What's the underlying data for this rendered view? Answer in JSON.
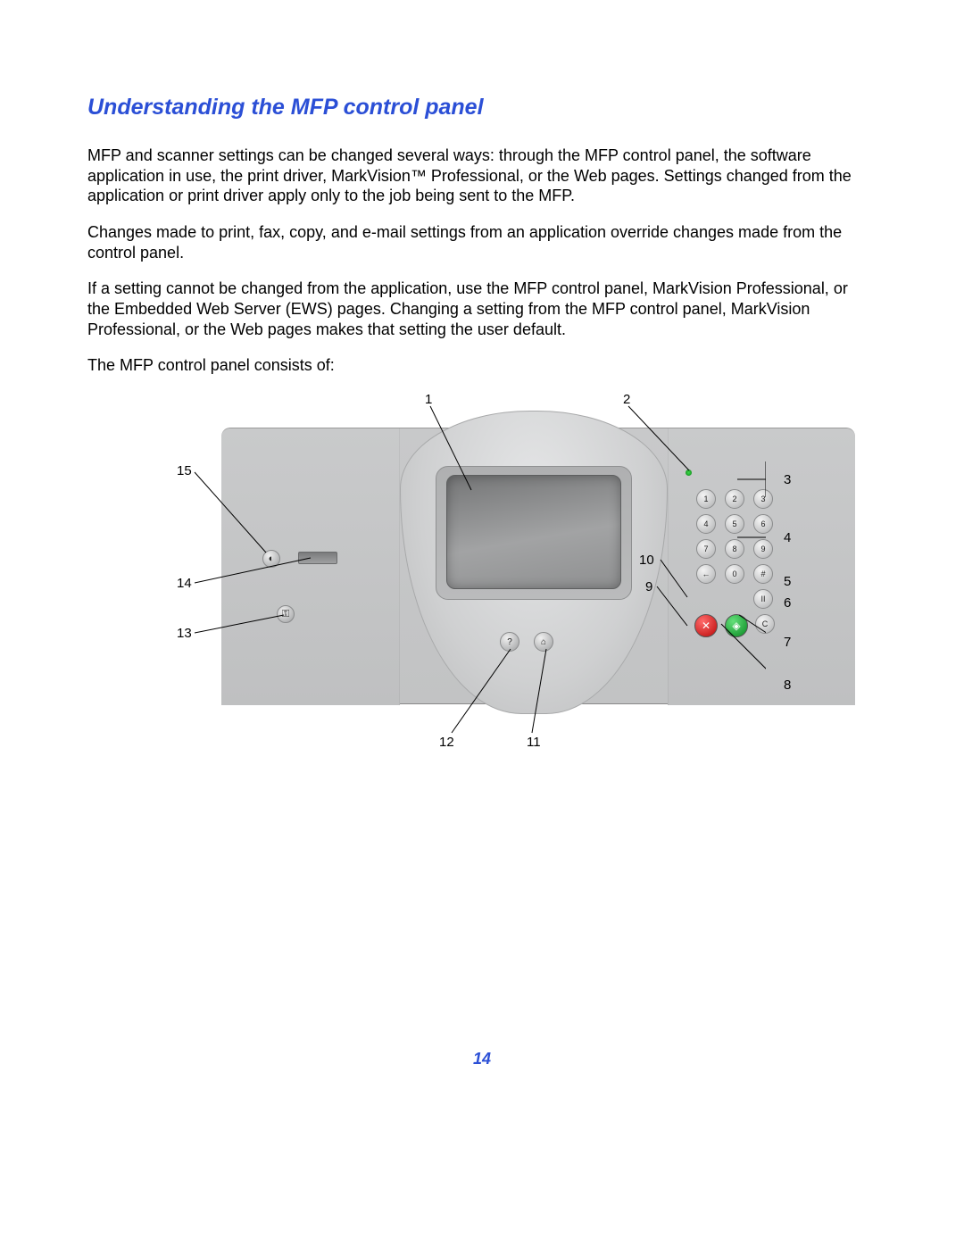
{
  "heading": "Understanding the MFP control panel",
  "paragraphs": {
    "p1": "MFP and scanner settings can be changed several ways: through the MFP control panel, the software application in use, the print driver, MarkVision™ Professional, or the Web pages. Settings changed from the application or print driver apply only to the job being sent to the MFP.",
    "p2": "Changes made to print, fax, copy, and e-mail settings from an application override changes made from the control panel.",
    "p3": "If a setting cannot be changed from the application, use the MFP control panel, MarkVision Professional, or the Embedded Web Server (EWS) pages. Changing a setting from the MFP control panel, MarkVision Professional, or the Web pages makes that setting the user default.",
    "p4": "The MFP control panel consists of:"
  },
  "callouts": {
    "c1": "1",
    "c2": "2",
    "c3": "3",
    "c4": "4",
    "c5": "5",
    "c6": "6",
    "c7": "7",
    "c8": "8",
    "c9": "9",
    "c10": "10",
    "c11": "11",
    "c12": "12",
    "c13": "13",
    "c14": "14",
    "c15": "15"
  },
  "keypad": {
    "row1": [
      "1",
      "2",
      "3"
    ],
    "row2": [
      "4",
      "5",
      "6"
    ],
    "row3": [
      "7",
      "8",
      "9"
    ],
    "row4_center": "0",
    "back_key": "←",
    "hash_key": "#",
    "pause_key": "II"
  },
  "buttons": {
    "help_glyph": "?",
    "home_glyph": "⌂",
    "contrast_glyph": "◐",
    "key_glyph": "⚿",
    "stop_glyph": "✕",
    "start_glyph": "◈",
    "clear_glyph": "C"
  },
  "page_number": "14"
}
